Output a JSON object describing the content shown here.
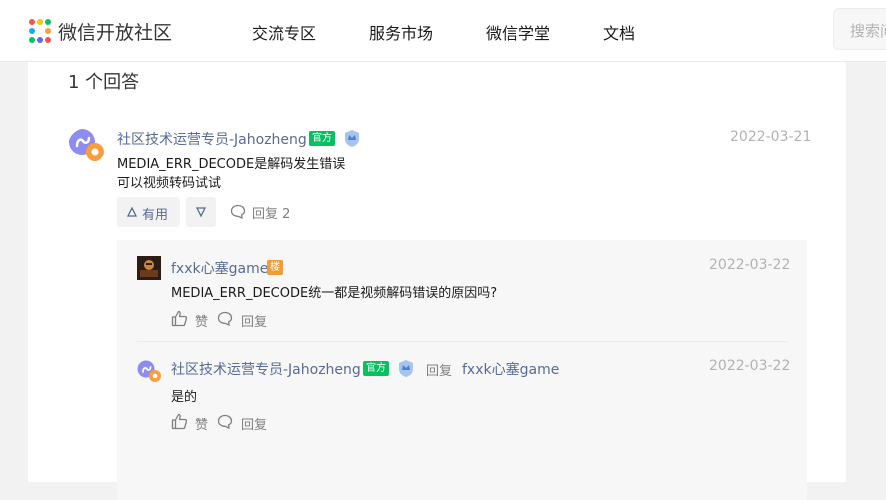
{
  "header": {
    "brand": "微信开放社区",
    "nav": [
      "交流专区",
      "服务市场",
      "微信学堂",
      "文档"
    ],
    "search_placeholder": "搜索问"
  },
  "answers": {
    "count_label": "1 个回答",
    "answer": {
      "user": "社区技术运营专员-Jahozheng",
      "badge": "官方",
      "date": "2022-03-21",
      "lines": [
        "MEDIA_ERR_DECODE是解码发生错误",
        "可以视频转码试试"
      ],
      "useful_label": "有用",
      "reply_label": "回复 2"
    },
    "replies": [
      {
        "user": "fxxk心塞game",
        "badge": "楼",
        "date": "2022-03-22",
        "text": "MEDIA_ERR_DECODE统一都是视频解码错误的原因吗?",
        "like_label": "赞",
        "reply_label": "回复"
      },
      {
        "user": "社区技术运营专员-Jahozheng",
        "badge": "官方",
        "reply_to_label": "回复",
        "reply_to_user": "fxxk心塞game",
        "date": "2022-03-22",
        "text": "是的",
        "like_label": "赞",
        "reply_label": "回复"
      }
    ]
  },
  "colors": {
    "link": "#576b95",
    "official": "#07c160",
    "op": "#f09b36"
  }
}
